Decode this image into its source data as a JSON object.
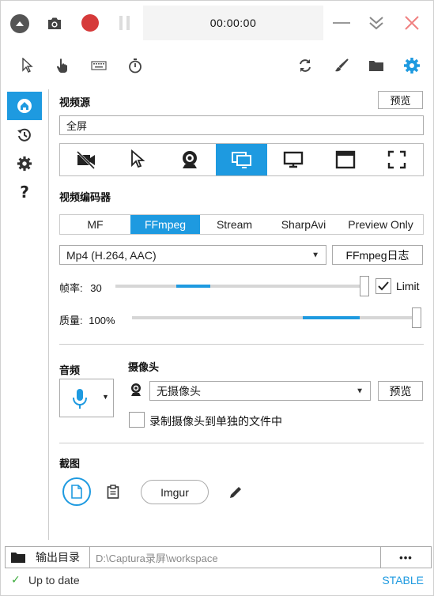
{
  "titlebar": {
    "timer": "00:00:00"
  },
  "video_source": {
    "label": "视频源",
    "preview_label": "预览",
    "value": "全屏",
    "active_index": 3
  },
  "video_encoder": {
    "label": "视频编码器",
    "tabs": [
      "MF",
      "FFmpeg",
      "Stream",
      "SharpAvi",
      "Preview Only"
    ],
    "active_tab": "FFmpeg",
    "codec": "Mp4 (H.264, AAC)",
    "log_button": "FFmpeg日志"
  },
  "framerate": {
    "label": "帧率:",
    "value": "30",
    "limit_label": "Limit",
    "limit_checked": true
  },
  "quality": {
    "label": "质量:",
    "value": "100%",
    "fraction": 1.0
  },
  "audio": {
    "label": "音频"
  },
  "webcam": {
    "label": "摄像头",
    "value": "无摄像头",
    "preview_label": "预览",
    "separate_file_label": "录制摄像头到单独的文件中"
  },
  "screenshot": {
    "label": "截图",
    "imgur_label": "Imgur"
  },
  "output": {
    "label": "输出目录",
    "path": "D:\\Captura录屏\\workspace",
    "more_label": "•••"
  },
  "status": {
    "text": "Up to date",
    "channel": "STABLE"
  },
  "colors": {
    "accent": "#1e9ae0",
    "record": "#d63a3a",
    "close": "#f08080",
    "status_ok": "#3aaa3a"
  }
}
